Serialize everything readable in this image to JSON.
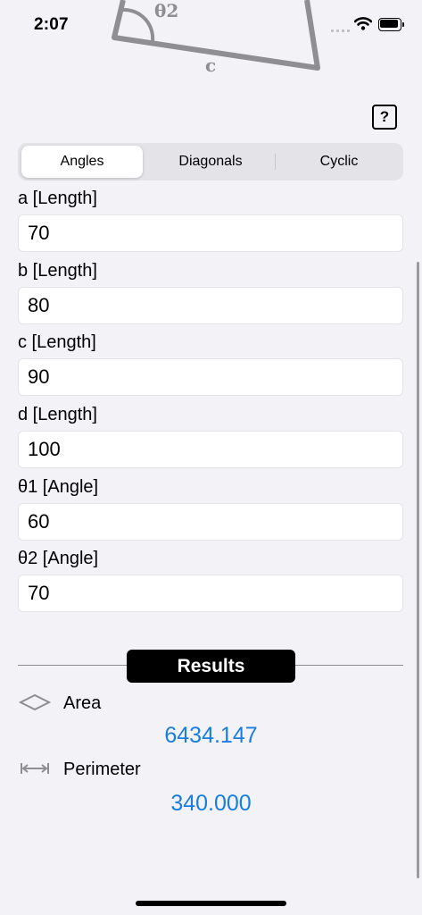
{
  "status_bar": {
    "time": "2:07"
  },
  "diagram": {
    "angle_label": "θ2",
    "side_label": "c"
  },
  "help": {
    "label": "?"
  },
  "tabs": [
    {
      "label": "Angles",
      "selected": true
    },
    {
      "label": "Diagonals",
      "selected": false
    },
    {
      "label": "Cyclic",
      "selected": false
    }
  ],
  "fields": [
    {
      "label": "a [Length]",
      "value": "70"
    },
    {
      "label": "b [Length]",
      "value": "80"
    },
    {
      "label": "c [Length]",
      "value": "90"
    },
    {
      "label": "d [Length]",
      "value": "100"
    },
    {
      "label": "θ1 [Angle]",
      "value": "60"
    },
    {
      "label": "θ2 [Angle]",
      "value": "70"
    }
  ],
  "results": {
    "title": "Results",
    "area": {
      "label": "Area",
      "value": "6434.147",
      "icon": "rhombus-icon"
    },
    "perimeter": {
      "label": "Perimeter",
      "value": "340.000",
      "icon": "width-arrows-icon"
    }
  },
  "colors": {
    "accent": "#1a7ee0",
    "background": "#f2f2f7",
    "pill": "#000000"
  }
}
